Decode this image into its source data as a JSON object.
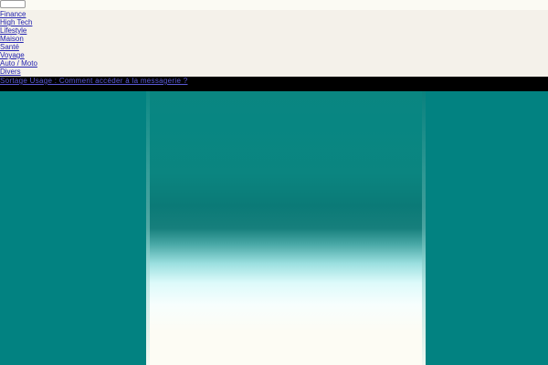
{
  "header": {
    "search": {
      "placeholder": "",
      "value": ""
    }
  },
  "nav": {
    "items": [
      {
        "label": "Finance"
      },
      {
        "label": "High Tech"
      },
      {
        "label": "Lifestyle"
      },
      {
        "label": "Maison"
      },
      {
        "label": "Santé"
      },
      {
        "label": "Voyage"
      },
      {
        "label": "Auto / Moto"
      },
      {
        "label": "Divers"
      }
    ]
  },
  "ticker": {
    "text": "Sortage Usage : Comment accéder à la messagerie ?"
  },
  "colors": {
    "link": "#2323b0",
    "ticker_bg": "#000000",
    "ticker_text": "#5b5bd8",
    "hero_bg": "#028281",
    "nav_bg": "#f4f1ea"
  }
}
